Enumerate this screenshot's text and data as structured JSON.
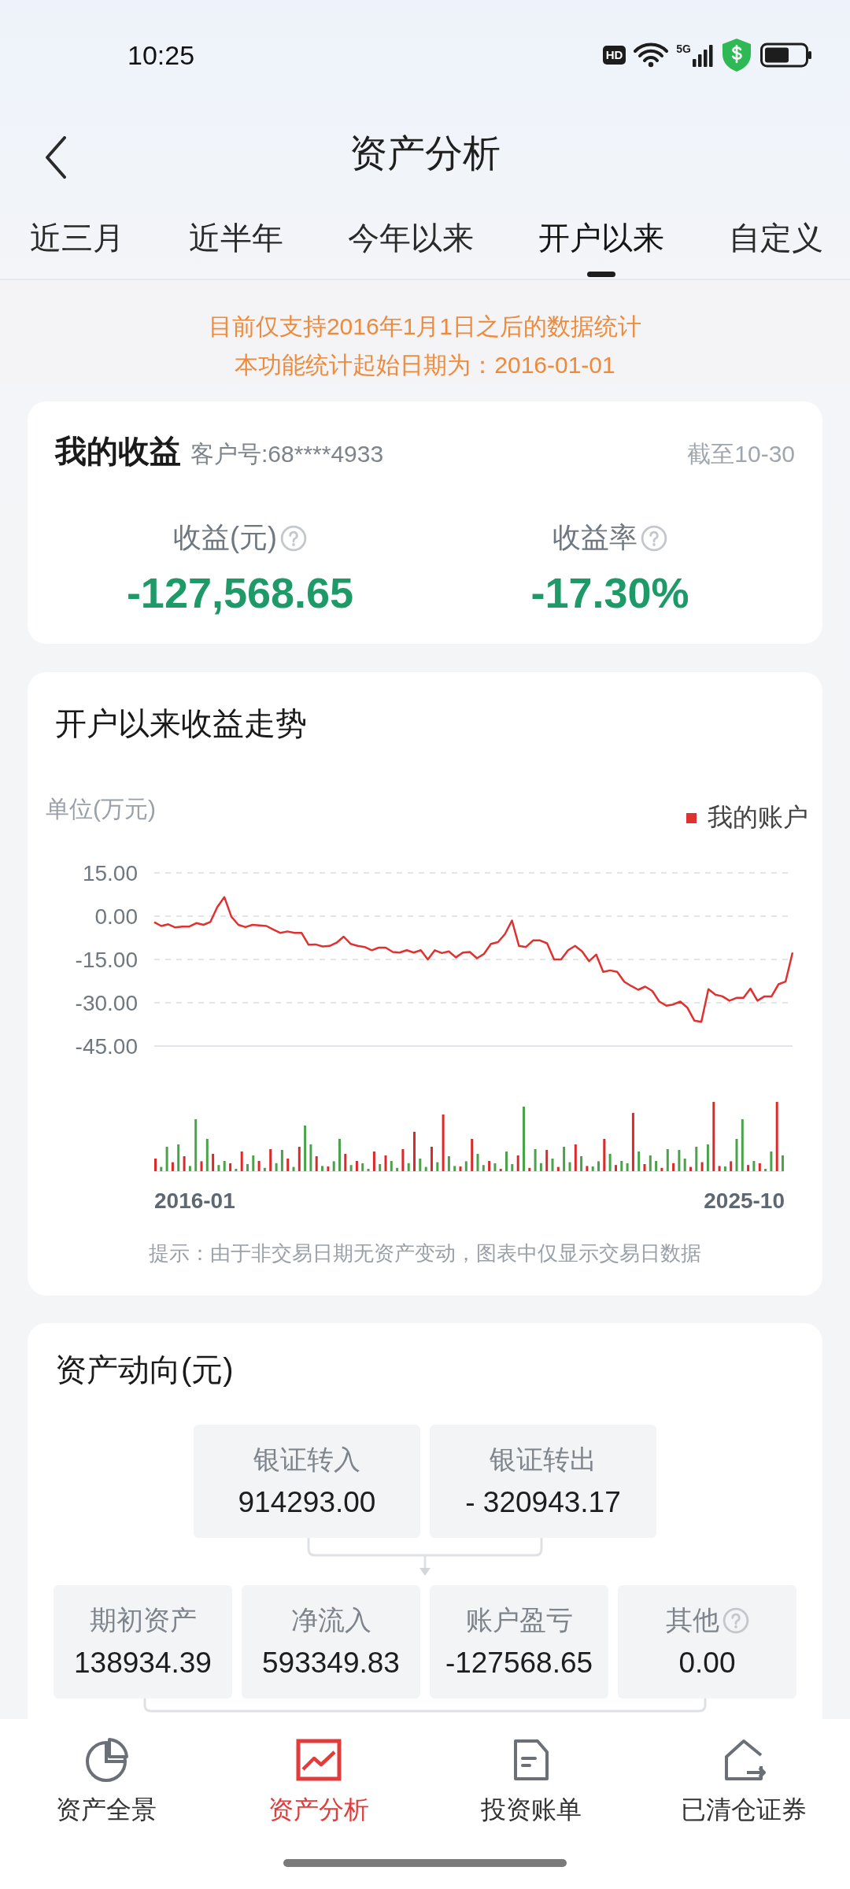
{
  "status_bar": {
    "time": "10:25",
    "hd_label": "HD",
    "network_label": "5G"
  },
  "header": {
    "title": "资产分析"
  },
  "tabs": [
    {
      "label": "近三月",
      "selected": false
    },
    {
      "label": "近半年",
      "selected": false
    },
    {
      "label": "今年以来",
      "selected": false
    },
    {
      "label": "开户以来",
      "selected": true
    },
    {
      "label": "自定义",
      "selected": false
    }
  ],
  "notice": [
    "目前仅支持2016年1月1日之后的数据统计",
    "本功能统计起始日期为：2016-01-01"
  ],
  "earnings_card": {
    "title": "我的收益",
    "customer_no": "客户号:68****4933",
    "as_of": "截至10-30",
    "metrics": [
      {
        "label": "收益(元)",
        "value": "-127,568.65",
        "help": true
      },
      {
        "label": "收益率",
        "value": "-17.30%",
        "help": true
      }
    ]
  },
  "trend_card": {
    "title": "开户以来收益走势",
    "unit": "单位(万元)",
    "x_labels": [
      "2016-01",
      "2025-10"
    ],
    "hint": "提示：由于非交易日期无资产变动，图表中仅显示交易日数据",
    "chart_data": {
      "type": "line",
      "ylim": [
        -45,
        15
      ],
      "yticks": [
        {
          "value": 15,
          "label": "15.00"
        },
        {
          "value": 0,
          "label": "0.00"
        },
        {
          "value": -15,
          "label": "-15.00"
        },
        {
          "value": -30,
          "label": "-30.00"
        },
        {
          "value": -45,
          "label": "-45.00"
        }
      ],
      "grid": true,
      "series": [
        {
          "name": "我的账户",
          "color": "#e03131",
          "values": [
            -2.1,
            -3.4,
            -2.8,
            -3.9,
            -3.6,
            -3.6,
            -2.4,
            -3,
            -2,
            3.2,
            6.6,
            -0.2,
            -3,
            -3.8,
            -3,
            -3.2,
            -3.4,
            -4.7,
            -5.8,
            -5.3,
            -5.8,
            -5.8,
            -9.9,
            -9.8,
            -10.5,
            -10.3,
            -9.2,
            -7.1,
            -9.6,
            -10.3,
            -10.7,
            -11.8,
            -10.9,
            -10.9,
            -12.4,
            -12.6,
            -11.8,
            -12.6,
            -11.8,
            -15,
            -11.8,
            -12.8,
            -12.2,
            -14.3,
            -12.6,
            -12.4,
            -14.6,
            -13.1,
            -9.6,
            -9,
            -6.2,
            -1.5,
            -10.3,
            -10.7,
            -8.4,
            -8.4,
            -9.4,
            -15,
            -15,
            -11.8,
            -10.3,
            -12.2,
            -15.6,
            -13.3,
            -19.3,
            -18.8,
            -19.3,
            -22.7,
            -24.2,
            -25.5,
            -24.4,
            -25.9,
            -29.6,
            -31,
            -30.6,
            -29.6,
            -31.7,
            -36.2,
            -36.6,
            -25.3,
            -27.2,
            -27.8,
            -29.3,
            -28.3,
            -28.3,
            -25.1,
            -29.3,
            -27.8,
            -27.8,
            -23.6,
            -22.7,
            -12.6
          ]
        }
      ]
    }
  },
  "flow_card": {
    "title": "资产动向(元)",
    "transfers": [
      {
        "label": "银证转入",
        "value": "914293.00"
      },
      {
        "label": "银证转出",
        "value": "- 320943.17"
      }
    ],
    "items": [
      {
        "label": "期初资产",
        "value": "138934.39",
        "help": false
      },
      {
        "label": "净流入",
        "value": "593349.83",
        "help": false
      },
      {
        "label": "账户盈亏",
        "value": "-127568.65",
        "help": false
      },
      {
        "label": "其他",
        "value": "0.00",
        "help": true
      }
    ]
  },
  "bottom_nav": [
    {
      "label": "资产全景",
      "kind": "pie",
      "selected": false
    },
    {
      "label": "资产分析",
      "kind": "chart",
      "selected": true
    },
    {
      "label": "投资账单",
      "kind": "document",
      "selected": false
    },
    {
      "label": "已清仓证券",
      "kind": "house",
      "selected": false
    }
  ]
}
